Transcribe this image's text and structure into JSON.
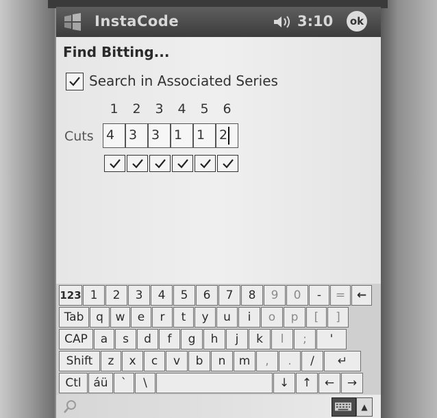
{
  "titlebar": {
    "app_title": "InstaCode",
    "time": "3:10",
    "ok_label": "ok"
  },
  "form": {
    "heading": "Find Bitting...",
    "assoc_label": "Search in Associated Series",
    "assoc_checked": true,
    "cuts_label": "Cuts",
    "positions": [
      "1",
      "2",
      "3",
      "4",
      "5",
      "6"
    ],
    "cuts": [
      "4",
      "3",
      "3",
      "1",
      "1",
      "2"
    ],
    "cut_checked": [
      true,
      true,
      true,
      true,
      true,
      true
    ]
  },
  "keyboard": {
    "rows": [
      [
        "123",
        "1",
        "2",
        "3",
        "4",
        "5",
        "6",
        "7",
        "8",
        "9",
        "0",
        "-",
        "=",
        "←"
      ],
      [
        "Tab",
        "q",
        "w",
        "e",
        "r",
        "t",
        "y",
        "u",
        "i",
        "o",
        "p",
        "[",
        "]"
      ],
      [
        "CAP",
        "a",
        "s",
        "d",
        "f",
        "g",
        "h",
        "j",
        "k",
        "l",
        ";",
        "'"
      ],
      [
        "Shift",
        "z",
        "x",
        "c",
        "v",
        "b",
        "n",
        "m",
        ",",
        ".",
        "/",
        "↵"
      ],
      [
        "Ctl",
        "áü",
        "`",
        "\\",
        "",
        "↓",
        "↑",
        "←",
        "→"
      ]
    ]
  },
  "icons": {
    "start": "windows-logo-icon",
    "volume": "speaker-icon",
    "sip": "keyboard-icon",
    "search": "search-icon"
  },
  "colors": {
    "titlebar": "#4a4a4a",
    "screen": "#e9e9e9"
  }
}
